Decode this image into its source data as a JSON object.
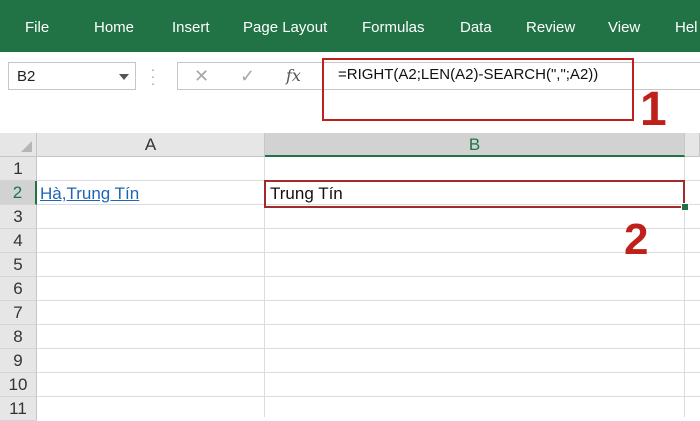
{
  "ribbon": {
    "tabs": [
      "File",
      "Home",
      "Insert",
      "Page Layout",
      "Formulas",
      "Data",
      "Review",
      "View",
      "Hel"
    ]
  },
  "formula_bar": {
    "name_box": "B2",
    "cancel_icon": "✕",
    "enter_icon": "✓",
    "fx_label": "fx",
    "formula": "=RIGHT(A2;LEN(A2)-SEARCH(\",\";A2))"
  },
  "annotations": {
    "marker_1": "1",
    "marker_2": "2",
    "highlight_color": "#c0201b"
  },
  "sheet": {
    "columns": [
      "A",
      "B"
    ],
    "rows": [
      "1",
      "2",
      "3",
      "4",
      "5",
      "6",
      "7",
      "8",
      "9",
      "10",
      "11"
    ],
    "cells": {
      "A2": "Hà,Trung Tín",
      "B2": "Trung Tín"
    },
    "accent_color": "#217346"
  }
}
